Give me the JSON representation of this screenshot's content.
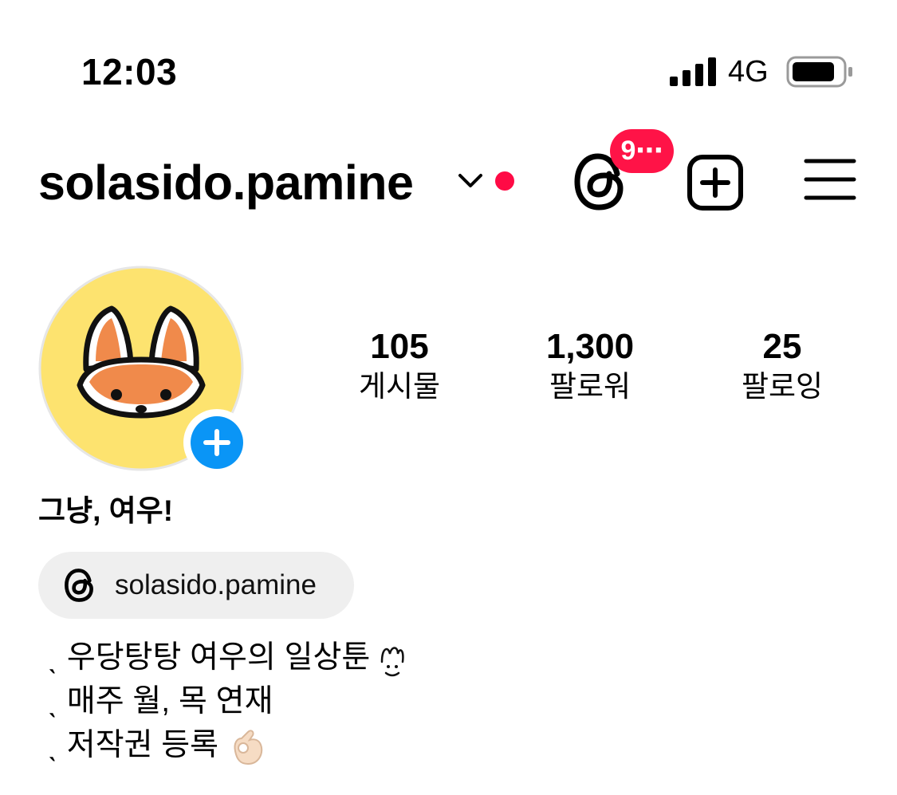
{
  "status_bar": {
    "time": "12:03",
    "network": "4G"
  },
  "header": {
    "username": "solasido.pamine",
    "threads_badge": "9⋯",
    "icons": [
      "chevron-down-icon",
      "threads-icon",
      "add-square-icon",
      "menu-icon"
    ],
    "notification_dot_color": "#ff0a45"
  },
  "profile": {
    "stats": [
      {
        "value": "105",
        "label": "게시물"
      },
      {
        "value": "1,300",
        "label": "팔로워"
      },
      {
        "value": "25",
        "label": "팔로잉"
      }
    ],
    "display_name": "그냥, 여우!",
    "threads_handle": "solasido.pamine",
    "bio_lines": [
      "ˎ 우당탕탕 여우의 일상툰",
      "ˎ 매주 월, 목 연재",
      "ˎ 저작권 등록"
    ]
  },
  "colors": {
    "badge": "#ff1347",
    "add_button": "#0a95f6",
    "avatar_bg": "#fde36f",
    "chip_bg": "#efefef"
  }
}
